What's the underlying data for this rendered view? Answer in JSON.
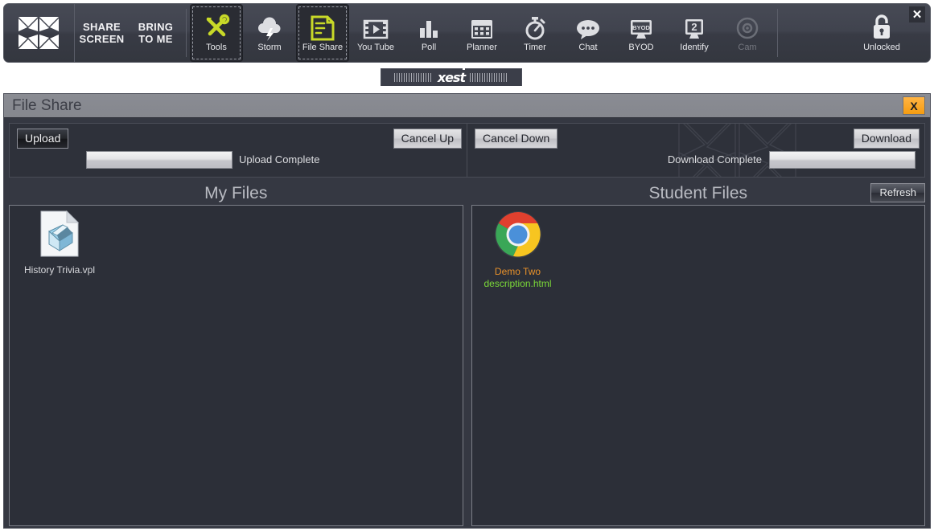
{
  "toolbar": {
    "logo_name": "xest-logo",
    "text_buttons": [
      {
        "line1": "SHARE",
        "line2": "SCREEN",
        "name": "share-screen-button"
      },
      {
        "line1": "BRING",
        "line2": "TO ME",
        "name": "bring-to-me-button"
      }
    ],
    "buttons": [
      {
        "label": "Tools",
        "icon": "wrench-screwdriver-icon",
        "selected": true,
        "disabled": false
      },
      {
        "label": "Storm",
        "icon": "cloud-lightning-icon",
        "selected": false,
        "disabled": false
      },
      {
        "label": "File Share",
        "icon": "document-icon",
        "selected": true,
        "disabled": false
      },
      {
        "label": "You Tube",
        "icon": "video-filmstrip-icon",
        "selected": false,
        "disabled": false
      },
      {
        "label": "Poll",
        "icon": "bar-chart-icon",
        "selected": false,
        "disabled": false
      },
      {
        "label": "Planner",
        "icon": "calendar-icon",
        "selected": false,
        "disabled": false
      },
      {
        "label": "Timer",
        "icon": "stopwatch-icon",
        "selected": false,
        "disabled": false
      },
      {
        "label": "Chat",
        "icon": "speech-bubble-icon",
        "selected": false,
        "disabled": false
      },
      {
        "label": "BYOD",
        "icon": "byod-monitor-icon",
        "selected": false,
        "disabled": false
      },
      {
        "label": "Identify",
        "icon": "monitor-number-2-icon",
        "selected": false,
        "disabled": false
      },
      {
        "label": "Cam",
        "icon": "camera-lens-icon",
        "selected": false,
        "disabled": true
      }
    ],
    "lock": {
      "label": "Unlocked",
      "icon": "open-padlock-icon"
    },
    "close_label": "✕",
    "accent_color": "#c8d928"
  },
  "xest_tab": {
    "text": "xest",
    "name": "xest-tab"
  },
  "window": {
    "title": "File Share",
    "close_label": "X"
  },
  "transfer": {
    "upload_button": "Upload",
    "cancel_up_button": "Cancel Up",
    "upload_status": "Upload Complete",
    "upload_progress": 100,
    "cancel_down_button": "Cancel Down",
    "download_button": "Download",
    "download_status": "Download Complete",
    "download_progress": 100
  },
  "my_files": {
    "title": "My Files",
    "items": [
      {
        "name": "History Trivia.vpl",
        "icon": "vpl-document-icon"
      }
    ]
  },
  "student_files": {
    "title": "Student Files",
    "refresh_button": "Refresh",
    "items": [
      {
        "owner": "Demo Two",
        "name": "description.html",
        "icon": "chrome-icon"
      }
    ]
  }
}
